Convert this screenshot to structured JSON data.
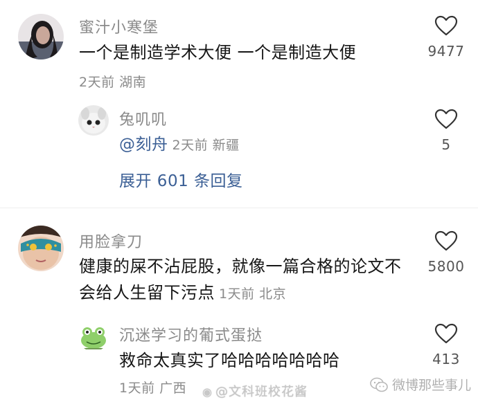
{
  "comments": [
    {
      "username": "蜜汁小寒堡",
      "body": "一个是制造学术大便 一个是制造大便",
      "meta": "2天前 湖南",
      "likes": "9477",
      "reply": {
        "username": "兔叽叽",
        "mention": "@刻舟",
        "meta": "2天前 新疆",
        "likes": "5"
      },
      "expand_label": "展开 601 条回复"
    },
    {
      "username": "用脸拿刀",
      "body_line1": "健康的屎不沾屁股，就像一篇合格的论文不",
      "body_line2": "会给人生留下污点",
      "meta": "1天前 北京",
      "likes": "5800",
      "reply": {
        "username": "沉迷学习的葡式蛋挞",
        "body": "救命太真实了哈哈哈哈哈哈哈",
        "meta": "1天前 广西",
        "likes": "413"
      }
    }
  ],
  "watermarks": {
    "weibo": "@文科班校花酱",
    "wechat": "微博那些事儿"
  },
  "icons": {
    "like": "heart-outline-icon",
    "wechat": "wechat-icon"
  },
  "colors": {
    "link": "#3b5f95",
    "meta": "#8a8a8a"
  }
}
